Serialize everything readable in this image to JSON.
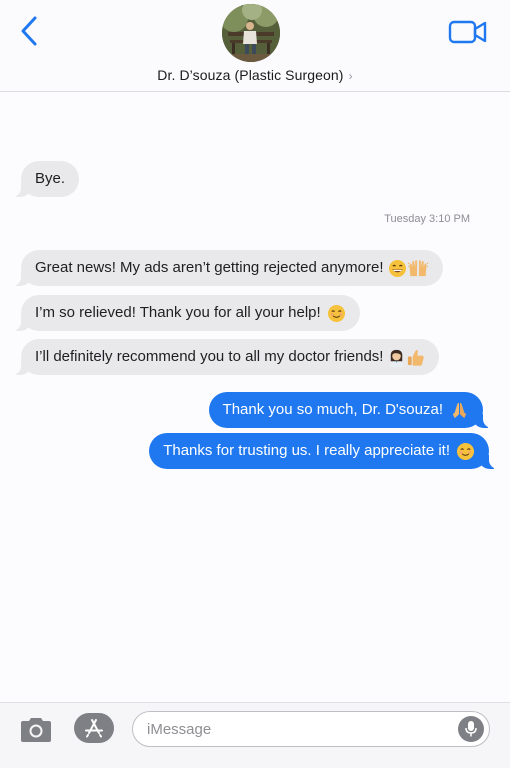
{
  "header": {
    "contact_name": "Dr. D’souza (Plastic Surgeon)",
    "chevron": "›",
    "back_icon": "chevron-left-icon",
    "video_icon": "video-camera-icon"
  },
  "timestamp": "Tuesday 3:10 PM",
  "messages": [
    {
      "direction": "incoming",
      "text": "Bye."
    },
    {
      "direction": "incoming",
      "text": "Great news! My ads aren’t getting rejected anymore!",
      "emoji": [
        "grinning-face-icon",
        "raising-hands-icon"
      ]
    },
    {
      "direction": "incoming",
      "text": "I’m so relieved! Thank you for all your help!",
      "emoji": [
        "smiling-face-icon"
      ]
    },
    {
      "direction": "incoming",
      "text": "I’ll definitely recommend you to all my doctor friends!",
      "emoji": [
        "woman-health-worker-icon",
        "thumbs-up-icon"
      ]
    },
    {
      "direction": "outgoing",
      "text": "Thank you so much, Dr. D'souza!",
      "emoji": [
        "folded-hands-icon"
      ]
    },
    {
      "direction": "outgoing",
      "text": "Thanks for trusting us. I really appreciate it!",
      "emoji": [
        "smiling-face-icon"
      ]
    }
  ],
  "compose": {
    "placeholder": "iMessage",
    "value": ""
  },
  "colors": {
    "accent": "#1f78f0",
    "incoming_bubble": "#e9e9ec",
    "outgoing_bubble": "#1f78f0"
  }
}
